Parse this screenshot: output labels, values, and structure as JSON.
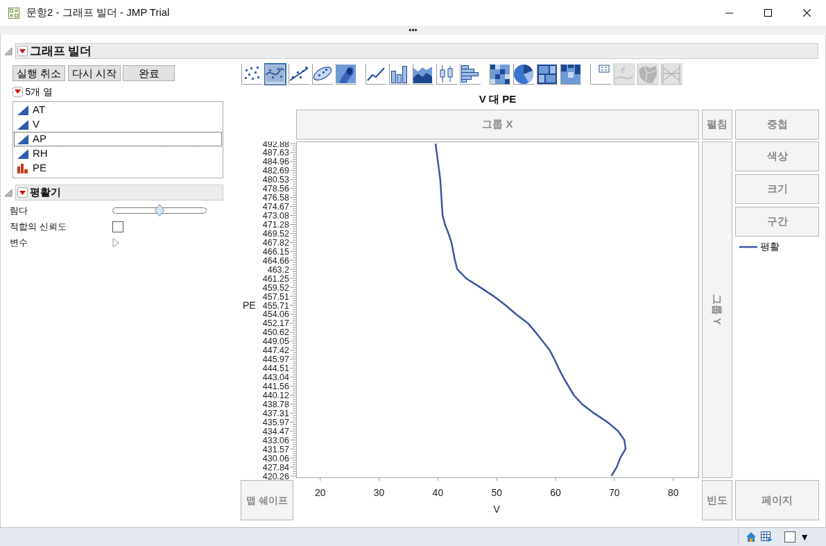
{
  "window": {
    "title": "문항2 - 그래프 빌더 - JMP Trial",
    "more": "•••"
  },
  "graph_builder": {
    "title": "그래프 빌더",
    "expanded": true,
    "buttons": [
      "실행 취소",
      "다시 시작",
      "완료"
    ],
    "columns_header": "5개 열",
    "columns": [
      {
        "name": "AT",
        "kind": "continuous",
        "focused": false
      },
      {
        "name": "V",
        "kind": "continuous",
        "focused": false
      },
      {
        "name": "AP",
        "kind": "continuous",
        "focused": true
      },
      {
        "name": "RH",
        "kind": "continuous",
        "focused": false
      },
      {
        "name": "PE",
        "kind": "ordinal",
        "focused": false
      }
    ],
    "smoother": {
      "title": "평활기",
      "expanded": true,
      "lambda": {
        "label": "람다",
        "level": 0.5
      },
      "confidence": {
        "label": "적합의 신뢰도",
        "checked": false
      },
      "variables": {
        "label": "변수",
        "expanded": false
      }
    },
    "toolbar": [
      [
        {
          "kind": "points",
          "selected": false,
          "disabled": false
        },
        {
          "kind": "smoother",
          "selected": true,
          "disabled": false
        },
        {
          "kind": "line-fit",
          "selected": false,
          "disabled": false
        },
        {
          "kind": "ellipse",
          "selected": false,
          "disabled": false
        },
        {
          "kind": "contour",
          "selected": false,
          "disabled": false
        }
      ],
      [
        {
          "kind": "line",
          "selected": false,
          "disabled": false
        },
        {
          "kind": "bar",
          "selected": false,
          "disabled": false
        },
        {
          "kind": "area",
          "selected": false,
          "disabled": false
        },
        {
          "kind": "box",
          "selected": false,
          "disabled": false
        },
        {
          "kind": "histogram",
          "selected": false,
          "disabled": false
        }
      ],
      [
        {
          "kind": "heatmap",
          "selected": false,
          "disabled": false
        },
        {
          "kind": "pie",
          "selected": false,
          "disabled": false
        },
        {
          "kind": "treemap",
          "selected": false,
          "disabled": false
        },
        {
          "kind": "mosaic",
          "selected": false,
          "disabled": false
        }
      ],
      [
        {
          "kind": "caption",
          "selected": false,
          "disabled": false
        },
        {
          "kind": "formula",
          "selected": false,
          "disabled": true
        },
        {
          "kind": "map",
          "selected": false,
          "disabled": true
        },
        {
          "kind": "parallel",
          "selected": false,
          "disabled": true
        }
      ]
    ],
    "graph_title": "V 대 PE",
    "zones": {
      "group_x": "그룹 X",
      "wrap": "펼침",
      "overlay": "중첩",
      "coloring": "색상",
      "size": "크기",
      "interval": "구간",
      "group_y": "그룹 Y",
      "map_shape": "맵 쉐이프",
      "freq": "빈도",
      "page": "페이지"
    },
    "chart_data": {
      "type": "line",
      "orientation": "horizontal",
      "xlabel": "V",
      "ylabel": "PE",
      "categories": [
        "492.88",
        "487.63",
        "484.96",
        "482.69",
        "480.53",
        "478.56",
        "476.58",
        "474.67",
        "473.08",
        "471.28",
        "469.52",
        "467.82",
        "466.15",
        "464.66",
        "463.2",
        "461.25",
        "459.52",
        "457.51",
        "455.71",
        "454.06",
        "452.17",
        "450.62",
        "449.05",
        "447.42",
        "445.97",
        "444.51",
        "443.04",
        "441.56",
        "440.12",
        "438.78",
        "437.31",
        "435.97",
        "434.47",
        "433.06",
        "431.57",
        "430.06",
        "427.84",
        "420.26"
      ],
      "series": [
        {
          "name": "평활",
          "color": "#3b55a0",
          "values": [
            39.6,
            39.8,
            40.0,
            40.2,
            40.4,
            40.5,
            40.6,
            40.7,
            40.8,
            41.2,
            41.8,
            42.3,
            42.6,
            42.9,
            43.3,
            44.8,
            47.2,
            49.5,
            51.5,
            53.3,
            55.3,
            56.6,
            57.8,
            59.0,
            59.8,
            60.5,
            61.3,
            62.2,
            63.1,
            64.5,
            66.5,
            68.8,
            70.6,
            71.7,
            71.9,
            71.0,
            70.4,
            69.5
          ]
        }
      ],
      "xlim": [
        15.9,
        84.4
      ],
      "xticks": [
        20,
        30,
        40,
        50,
        60,
        70,
        80
      ]
    }
  },
  "status_bar": {
    "menu": "▼"
  }
}
